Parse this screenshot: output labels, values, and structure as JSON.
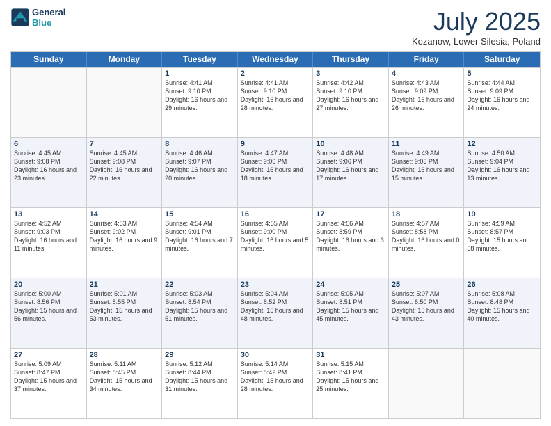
{
  "header": {
    "logo_line1": "General",
    "logo_line2": "Blue",
    "month": "July 2025",
    "location": "Kozanow, Lower Silesia, Poland"
  },
  "days_of_week": [
    "Sunday",
    "Monday",
    "Tuesday",
    "Wednesday",
    "Thursday",
    "Friday",
    "Saturday"
  ],
  "weeks": [
    [
      {
        "day": "",
        "info": ""
      },
      {
        "day": "",
        "info": ""
      },
      {
        "day": "1",
        "info": "Sunrise: 4:41 AM\nSunset: 9:10 PM\nDaylight: 16 hours and 29 minutes."
      },
      {
        "day": "2",
        "info": "Sunrise: 4:41 AM\nSunset: 9:10 PM\nDaylight: 16 hours and 28 minutes."
      },
      {
        "day": "3",
        "info": "Sunrise: 4:42 AM\nSunset: 9:10 PM\nDaylight: 16 hours and 27 minutes."
      },
      {
        "day": "4",
        "info": "Sunrise: 4:43 AM\nSunset: 9:09 PM\nDaylight: 16 hours and 26 minutes."
      },
      {
        "day": "5",
        "info": "Sunrise: 4:44 AM\nSunset: 9:09 PM\nDaylight: 16 hours and 24 minutes."
      }
    ],
    [
      {
        "day": "6",
        "info": "Sunrise: 4:45 AM\nSunset: 9:08 PM\nDaylight: 16 hours and 23 minutes."
      },
      {
        "day": "7",
        "info": "Sunrise: 4:45 AM\nSunset: 9:08 PM\nDaylight: 16 hours and 22 minutes."
      },
      {
        "day": "8",
        "info": "Sunrise: 4:46 AM\nSunset: 9:07 PM\nDaylight: 16 hours and 20 minutes."
      },
      {
        "day": "9",
        "info": "Sunrise: 4:47 AM\nSunset: 9:06 PM\nDaylight: 16 hours and 18 minutes."
      },
      {
        "day": "10",
        "info": "Sunrise: 4:48 AM\nSunset: 9:06 PM\nDaylight: 16 hours and 17 minutes."
      },
      {
        "day": "11",
        "info": "Sunrise: 4:49 AM\nSunset: 9:05 PM\nDaylight: 16 hours and 15 minutes."
      },
      {
        "day": "12",
        "info": "Sunrise: 4:50 AM\nSunset: 9:04 PM\nDaylight: 16 hours and 13 minutes."
      }
    ],
    [
      {
        "day": "13",
        "info": "Sunrise: 4:52 AM\nSunset: 9:03 PM\nDaylight: 16 hours and 11 minutes."
      },
      {
        "day": "14",
        "info": "Sunrise: 4:53 AM\nSunset: 9:02 PM\nDaylight: 16 hours and 9 minutes."
      },
      {
        "day": "15",
        "info": "Sunrise: 4:54 AM\nSunset: 9:01 PM\nDaylight: 16 hours and 7 minutes."
      },
      {
        "day": "16",
        "info": "Sunrise: 4:55 AM\nSunset: 9:00 PM\nDaylight: 16 hours and 5 minutes."
      },
      {
        "day": "17",
        "info": "Sunrise: 4:56 AM\nSunset: 8:59 PM\nDaylight: 16 hours and 3 minutes."
      },
      {
        "day": "18",
        "info": "Sunrise: 4:57 AM\nSunset: 8:58 PM\nDaylight: 16 hours and 0 minutes."
      },
      {
        "day": "19",
        "info": "Sunrise: 4:59 AM\nSunset: 8:57 PM\nDaylight: 15 hours and 58 minutes."
      }
    ],
    [
      {
        "day": "20",
        "info": "Sunrise: 5:00 AM\nSunset: 8:56 PM\nDaylight: 15 hours and 56 minutes."
      },
      {
        "day": "21",
        "info": "Sunrise: 5:01 AM\nSunset: 8:55 PM\nDaylight: 15 hours and 53 minutes."
      },
      {
        "day": "22",
        "info": "Sunrise: 5:03 AM\nSunset: 8:54 PM\nDaylight: 15 hours and 51 minutes."
      },
      {
        "day": "23",
        "info": "Sunrise: 5:04 AM\nSunset: 8:52 PM\nDaylight: 15 hours and 48 minutes."
      },
      {
        "day": "24",
        "info": "Sunrise: 5:05 AM\nSunset: 8:51 PM\nDaylight: 15 hours and 45 minutes."
      },
      {
        "day": "25",
        "info": "Sunrise: 5:07 AM\nSunset: 8:50 PM\nDaylight: 15 hours and 43 minutes."
      },
      {
        "day": "26",
        "info": "Sunrise: 5:08 AM\nSunset: 8:48 PM\nDaylight: 15 hours and 40 minutes."
      }
    ],
    [
      {
        "day": "27",
        "info": "Sunrise: 5:09 AM\nSunset: 8:47 PM\nDaylight: 15 hours and 37 minutes."
      },
      {
        "day": "28",
        "info": "Sunrise: 5:11 AM\nSunset: 8:45 PM\nDaylight: 15 hours and 34 minutes."
      },
      {
        "day": "29",
        "info": "Sunrise: 5:12 AM\nSunset: 8:44 PM\nDaylight: 15 hours and 31 minutes."
      },
      {
        "day": "30",
        "info": "Sunrise: 5:14 AM\nSunset: 8:42 PM\nDaylight: 15 hours and 28 minutes."
      },
      {
        "day": "31",
        "info": "Sunrise: 5:15 AM\nSunset: 8:41 PM\nDaylight: 15 hours and 25 minutes."
      },
      {
        "day": "",
        "info": ""
      },
      {
        "day": "",
        "info": ""
      }
    ]
  ]
}
